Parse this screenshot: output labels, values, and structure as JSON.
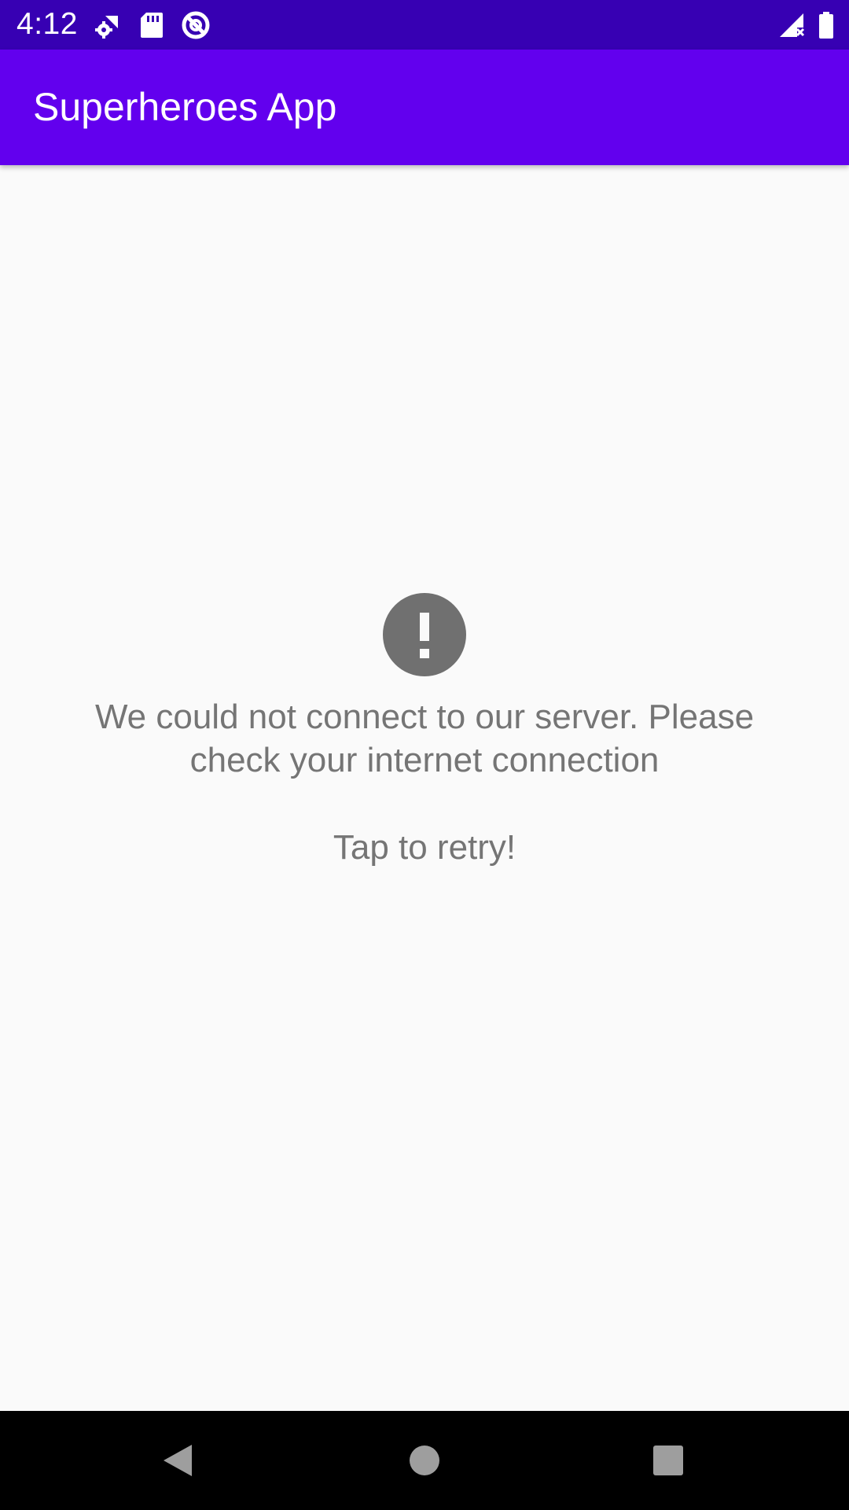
{
  "status_bar": {
    "time": "4:12",
    "left_icons": [
      "settings-wifi-icon",
      "sd-card-icon",
      "do-not-disturb-icon"
    ],
    "right_icons": [
      "signal-no-service-icon",
      "battery-icon"
    ],
    "background": "#3700b3"
  },
  "app_bar": {
    "title": "Superheroes App",
    "background": "#6200ee"
  },
  "error_state": {
    "icon": "error-exclamation-icon",
    "message": "We could not connect to our server. Please check your internet connection",
    "retry_label": "Tap to retry!",
    "text_color": "#757575"
  },
  "nav_bar": {
    "buttons": [
      "back-icon",
      "home-icon",
      "recents-icon"
    ]
  }
}
